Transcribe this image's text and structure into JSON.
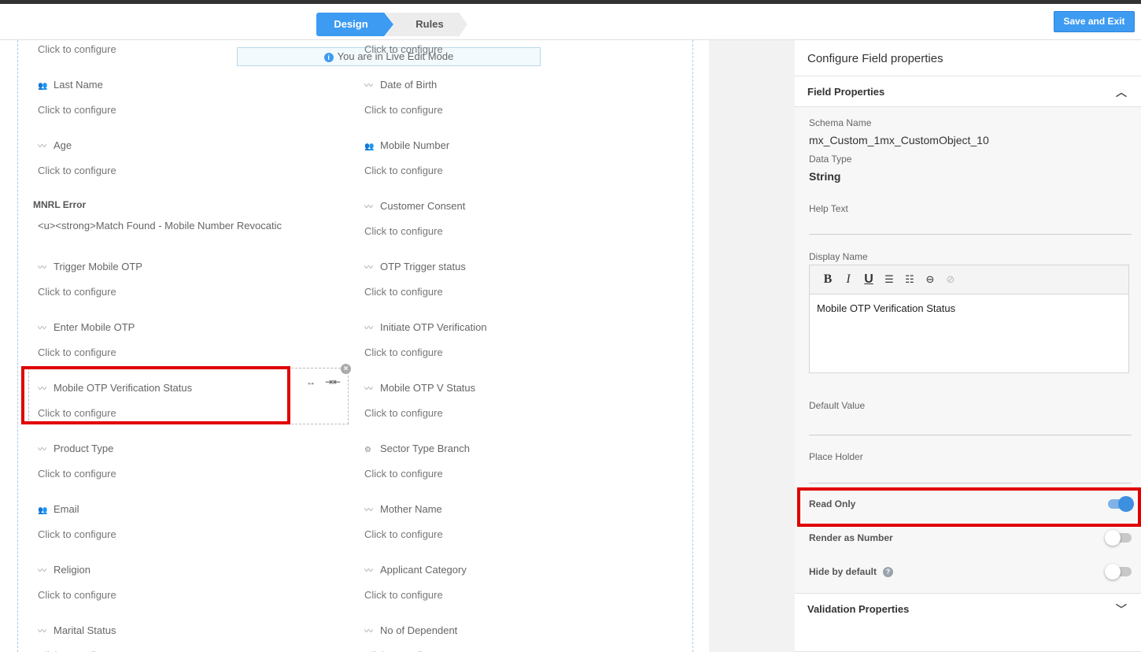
{
  "header": {
    "steps": [
      "Design",
      "Rules"
    ],
    "save_label": "Save and Exit"
  },
  "canvas": {
    "banner": "You are in Live Edit Mode",
    "sub_text": "Click to configure",
    "mnrl": {
      "label": "MNRL Error",
      "value": "<u><strong>Match Found - Mobile Number Revocatic"
    },
    "fields": [
      {
        "label": "",
        "icon": "pulse-icon"
      },
      {
        "label": "",
        "icon": "pulse-icon"
      },
      {
        "label": "Last Name",
        "icon": "people-icon"
      },
      {
        "label": "Date of Birth",
        "icon": "pulse-icon"
      },
      {
        "label": "Age",
        "icon": "pulse-icon"
      },
      {
        "label": "Mobile Number",
        "icon": "people-icon"
      },
      {
        "label": "Customer Consent",
        "icon": "pulse-icon"
      },
      {
        "label": "Trigger Mobile OTP",
        "icon": "pulse-icon"
      },
      {
        "label": "OTP Trigger status",
        "icon": "pulse-icon"
      },
      {
        "label": "Enter Mobile OTP",
        "icon": "pulse-icon"
      },
      {
        "label": "Initiate OTP Verification",
        "icon": "pulse-icon"
      },
      {
        "label": "Mobile OTP Verification Status",
        "icon": "pulse-icon"
      },
      {
        "label": "Mobile OTP V Status",
        "icon": "pulse-icon"
      },
      {
        "label": "Product Type",
        "icon": "pulse-icon"
      },
      {
        "label": "Sector Type Branch",
        "icon": "hierarchy-icon"
      },
      {
        "label": "Email",
        "icon": "people-icon"
      },
      {
        "label": "Mother Name",
        "icon": "pulse-icon"
      },
      {
        "label": "Religion",
        "icon": "pulse-icon"
      },
      {
        "label": "Applicant Category",
        "icon": "pulse-icon"
      },
      {
        "label": "Marital Status",
        "icon": "pulse-icon"
      },
      {
        "label": "No of Dependent",
        "icon": "pulse-icon"
      }
    ]
  },
  "panel": {
    "title": "Configure Field properties",
    "field_properties_title": "Field Properties",
    "schema_name_label": "Schema Name",
    "schema_name": "mx_Custom_1mx_CustomObject_10",
    "data_type_label": "Data Type",
    "data_type": "String",
    "help_text_label": "Help Text",
    "display_name_label": "Display Name",
    "display_name": "Mobile OTP Verification Status",
    "default_value_label": "Default Value",
    "placeholder_label": "Place Holder",
    "read_only_label": "Read Only",
    "read_only": true,
    "render_number_label": "Render as Number",
    "render_number": false,
    "hide_default_label": "Hide by default",
    "hide_default": false,
    "validation_title": "Validation Properties"
  }
}
